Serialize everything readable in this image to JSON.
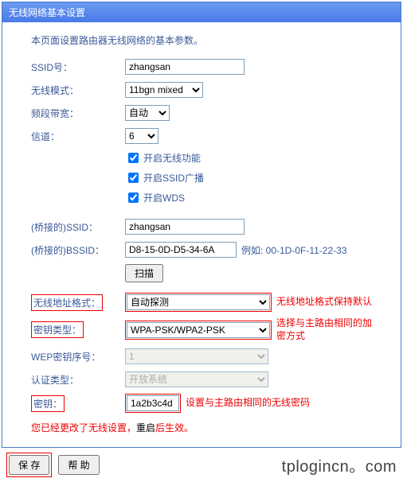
{
  "title": "无线网络基本设置",
  "description": "本页面设置路由器无线网络的基本参数。",
  "fields": {
    "ssid": {
      "label": "SSID号：",
      "value": "zhangsan"
    },
    "mode": {
      "label": "无线模式：",
      "value": "11bgn mixed"
    },
    "bandwidth": {
      "label": "频段带宽：",
      "value": "自动"
    },
    "channel": {
      "label": "信道：",
      "value": "6"
    }
  },
  "checkboxes": {
    "enable_wireless": {
      "label": "开启无线功能",
      "checked": true
    },
    "enable_ssid_broadcast": {
      "label": "开启SSID广播",
      "checked": true
    },
    "enable_wds": {
      "label": "开启WDS",
      "checked": true
    }
  },
  "bridge": {
    "ssid": {
      "label": "(桥接的)SSID：",
      "value": "zhangsan"
    },
    "bssid": {
      "label": "(桥接的)BSSID：",
      "value": "D8-15-0D-D5-34-6A",
      "hint": "例如: 00-1D-0F-11-22-33"
    },
    "scan_button": "扫描",
    "addr_format": {
      "label": "无线地址格式：",
      "value": "自动探测",
      "hint": "无线地址格式保持默认"
    },
    "key_type": {
      "label": "密钥类型：",
      "value": "WPA-PSK/WPA2-PSK",
      "hint": "选择与主路由相同的加密方式"
    },
    "wep_index": {
      "label": "WEP密钥序号：",
      "value": "1"
    },
    "auth_type": {
      "label": "认证类型：",
      "value": "开放系统"
    },
    "key": {
      "label": "密钥：",
      "value": "1a2b3c4d",
      "hint": "设置与主路由相同的无线密码"
    }
  },
  "warning": {
    "prefix": "您已经更改了无线设置，",
    "bold": "重启",
    "suffix": "后生效。"
  },
  "buttons": {
    "save": "保 存",
    "help": "帮 助"
  },
  "watermark": "tplogincn。com"
}
